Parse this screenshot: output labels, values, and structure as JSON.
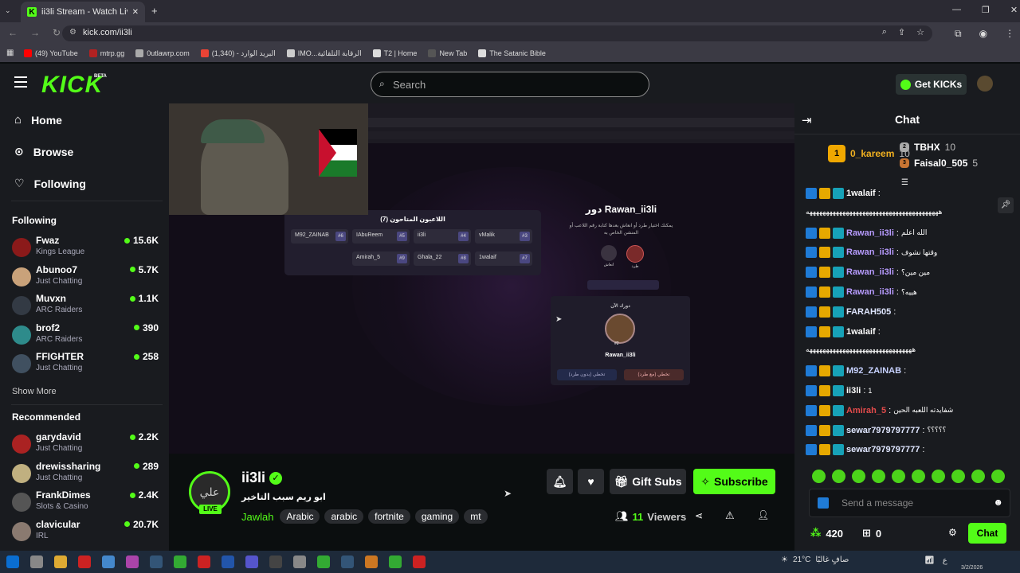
{
  "browser": {
    "tab_title": "ii3li Stream - Watch Live on Kick",
    "url": "kick.com/ii3li",
    "bookmarks": [
      {
        "label": "(49) YouTube",
        "color": "#ff0000"
      },
      {
        "label": "mtrp.gg",
        "color": "#b22222"
      },
      {
        "label": "0utlawrp.com",
        "color": "#aaaaaa"
      },
      {
        "label": "البريد الوارد - (1,340)",
        "color": "#ea4335"
      },
      {
        "label": "IMO...الرقابة التلقائية",
        "color": "#cccccc"
      },
      {
        "label": "T2 | Home",
        "color": "#dddddd"
      },
      {
        "label": "New Tab",
        "color": "#555555"
      },
      {
        "label": "The Satanic Bible",
        "color": "#dddddd"
      }
    ]
  },
  "header": {
    "logo": "KICK",
    "beta": "BETA",
    "search_placeholder": "Search",
    "get_kicks": "Get KICKs"
  },
  "sidebar": {
    "nav": [
      "Home",
      "Browse",
      "Following"
    ],
    "following_title": "Following",
    "following": [
      {
        "name": "Fwaz",
        "category": "Kings League",
        "viewers": "15.6K",
        "color": "#8b1a1a"
      },
      {
        "name": "Abunoo7",
        "category": "Just Chatting",
        "viewers": "5.7K",
        "color": "#c9a27a"
      },
      {
        "name": "Muvxn",
        "category": "ARC Raiders",
        "viewers": "1.1K",
        "color": "#333a44"
      },
      {
        "name": "brof2",
        "category": "ARC Raiders",
        "viewers": "390",
        "color": "#2e8b8b"
      },
      {
        "name": "FFIGHTER",
        "category": "Just Chatting",
        "viewers": "258",
        "color": "#405060"
      }
    ],
    "show_more": "Show More",
    "recommended_title": "Recommended",
    "recommended": [
      {
        "name": "garydavid",
        "category": "Just Chatting",
        "viewers": "2.2K",
        "color": "#aa2222"
      },
      {
        "name": "drewissharing",
        "category": "Just Chatting",
        "viewers": "289",
        "color": "#c0b080"
      },
      {
        "name": "FrankDimes",
        "category": "Slots & Casino",
        "viewers": "2.4K",
        "color": "#555555"
      },
      {
        "name": "clavicular",
        "category": "IRL",
        "viewers": "20.7K",
        "color": "#8a7a70"
      }
    ]
  },
  "video": {
    "players_title": "اللاعبون المتاحون (7)",
    "players": [
      {
        "name": "M92_ZAINAB",
        "num": "#6"
      },
      {
        "name": "IAbuReem",
        "num": "#5"
      },
      {
        "name": "ii3li",
        "num": "#4"
      },
      {
        "name": "vMalik",
        "num": "#3"
      },
      {
        "name": "Amirah_5",
        "num": "#9"
      },
      {
        "name": "Ghala_22",
        "num": "#8"
      },
      {
        "name": "1walaif",
        "num": "#7"
      }
    ],
    "turn_title": "دور Rawan_ii3li",
    "turn_desc": "يمكنك اختيار طرد أو انعاش بعدها كتابة رقم اللاعب أو المنشن الخاص به",
    "option_kick": "طرد",
    "option_revive": "انعاش",
    "your_turn": "دورك الآن",
    "current_player": "Rawan_ii3li",
    "current_num": "#2",
    "skip_no_kick": "تخطي (بدون طرد)",
    "skip_with_kick": "تخطي (مع طرد)"
  },
  "stream": {
    "channel": "ii3li",
    "avatar_text": "علي",
    "live": "LIVE",
    "title": "ابو ريم سبب التاخير",
    "category": "Jawlah",
    "tags": [
      "Arabic",
      "arabic",
      "fortnite",
      "gaming",
      "mt"
    ],
    "gift_subs": "Gift Subs",
    "subscribe": "Subscribe",
    "viewers_count": "11",
    "viewers_label": "Viewers"
  },
  "chat": {
    "title": "Chat",
    "leaders": [
      {
        "rank": "1",
        "name": "0_kareem",
        "count": "10"
      },
      {
        "rank": "2",
        "name": "TBHX",
        "count": "10"
      },
      {
        "rank": "3",
        "name": "Faisal0_505",
        "count": "5"
      }
    ],
    "messages": [
      {
        "user": "1walaif",
        "color": "#ffffff",
        "text": ""
      },
      {
        "user": "",
        "color": "#ffffff",
        "text": "ههههههههههههههههههههههههههههههههههههههههه"
      },
      {
        "user": "Rawan_ii3li",
        "color": "#b89cff",
        "text": "الله اعلم"
      },
      {
        "user": "Rawan_ii3li",
        "color": "#b89cff",
        "text": "وقتها نشوف"
      },
      {
        "user": "Rawan_ii3li",
        "color": "#b89cff",
        "text": "مين مين؟"
      },
      {
        "user": "Rawan_ii3li",
        "color": "#b89cff",
        "text": "هييه؟"
      },
      {
        "user": "FARAH505",
        "color": "#dfe6ff",
        "text": ""
      },
      {
        "user": "1walaif",
        "color": "#ffffff",
        "text": ""
      },
      {
        "user": "",
        "color": "#ffffff",
        "text": "ههههههههههههههههههههههههههههههههه"
      },
      {
        "user": "M92_ZAINAB",
        "color": "#c7d2ff",
        "text": ""
      },
      {
        "user": "ii3li",
        "color": "#ffffff",
        "text": "1"
      },
      {
        "user": "Amirah_5",
        "color": "#e24b4b",
        "text": "شفايدته اللعبه الحين"
      },
      {
        "user": "sewar7979797777",
        "color": "#dfe6ff",
        "text": "؟؟؟؟؟"
      },
      {
        "user": "sewar7979797777",
        "color": "#dfe6ff",
        "text": ""
      }
    ],
    "input_placeholder": "Send a message",
    "kicks": "420",
    "gifts": "0",
    "send": "Chat"
  },
  "taskbar": {
    "weather": "21°C",
    "weather_desc": "صافٍ غالبًا",
    "lang": "ع",
    "date": "3/2/2026"
  }
}
